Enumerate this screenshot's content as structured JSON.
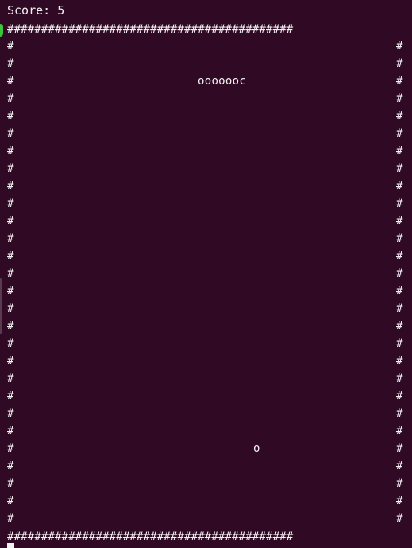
{
  "game": {
    "score_text": "Score: 5",
    "border_top": "##########################################",
    "border_bottom": "##########################################",
    "wall_char": "#",
    "snake_text": "ooooooc",
    "food_char": "o"
  },
  "colors": {
    "background": "#300a24",
    "foreground": "#f2f2f2",
    "status_indicator": "#3cc43c"
  }
}
